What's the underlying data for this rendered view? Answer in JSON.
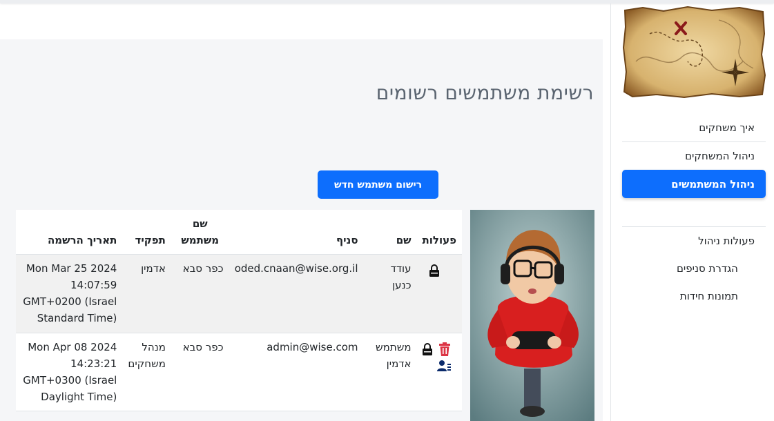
{
  "sidebar": {
    "items": [
      {
        "label": "איך משחקים"
      },
      {
        "label": "ניהול המשחקים"
      },
      {
        "label": "ניהול המשתמשים",
        "active": true
      },
      {
        "label": "פעולות ניהול"
      },
      {
        "label": "הגדרת סניפים"
      },
      {
        "label": "תמונות חידות"
      }
    ]
  },
  "main": {
    "title": "רשימת משתמשים רשומים",
    "register_button": "רישום משתמש חדש"
  },
  "table": {
    "headers": {
      "actions": "פעולות",
      "name": "שם",
      "branch": "סניף",
      "username": "שם משתמש",
      "role": "תפקיד",
      "registered": "תאריך הרשמה"
    },
    "rows": [
      {
        "name": "עודד כנען",
        "branch": "oded.cnaan@wise.org.il",
        "username": "כפר סבא",
        "role": "אדמין",
        "registered": "Mon Mar 25 2024 14:07:59 GMT+0200 (Israel Standard Time)",
        "actions": [
          "lock-icon"
        ]
      },
      {
        "name": "משתמש אדמין",
        "branch": "admin@wise.com",
        "username": "כפר סבא",
        "role": "מנהל משחקים",
        "registered": "Mon Apr 08 2024 14:23:21 GMT+0300 (Israel Daylight Time)",
        "actions": [
          "trash-icon",
          "lock-icon",
          "user-settings-icon"
        ]
      }
    ]
  },
  "colors": {
    "primary": "#0d6efd",
    "danger": "#dc3545",
    "background": "#f5f6f8"
  }
}
